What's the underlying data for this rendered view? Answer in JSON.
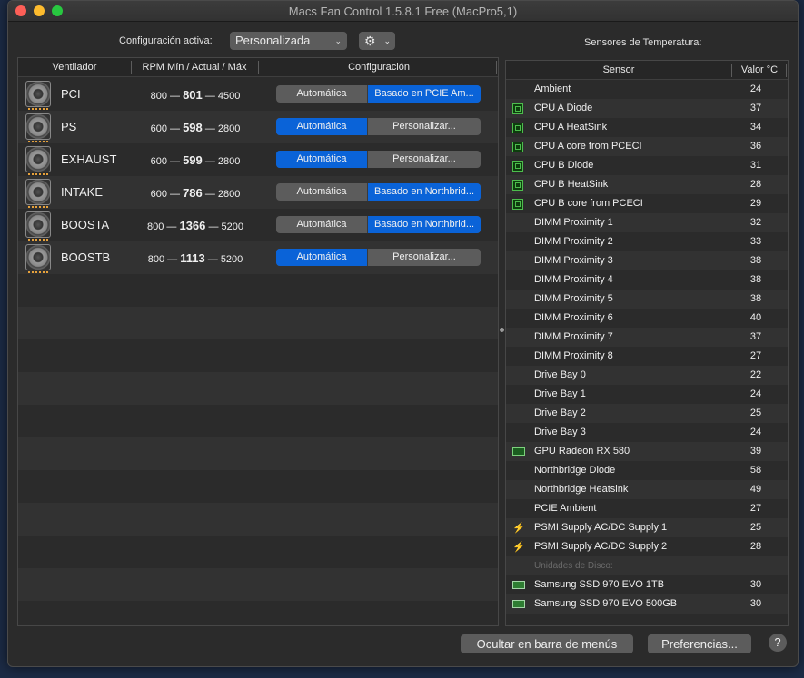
{
  "window": {
    "title": "Macs Fan Control 1.5.8.1 Free (MacPro5,1)"
  },
  "toolbar": {
    "config_label": "Configuración activa:",
    "config_value": "Personalizada",
    "sensors_label": "Sensores de Temperatura:"
  },
  "fans": {
    "headers": {
      "fan": "Ventilador",
      "rpm": "RPM Mín / Actual / Máx",
      "config": "Configuración"
    },
    "rows": [
      {
        "name": "PCI",
        "min": "800",
        "cur": "801",
        "max": "4500",
        "auto": "Automática",
        "custom": "Basado en PCIE Am...",
        "mode": "custom"
      },
      {
        "name": "PS",
        "min": "600",
        "cur": "598",
        "max": "2800",
        "auto": "Automática",
        "custom": "Personalizar...",
        "mode": "auto"
      },
      {
        "name": "EXHAUST",
        "min": "600",
        "cur": "599",
        "max": "2800",
        "auto": "Automática",
        "custom": "Personalizar...",
        "mode": "auto"
      },
      {
        "name": "INTAKE",
        "min": "600",
        "cur": "786",
        "max": "2800",
        "auto": "Automática",
        "custom": "Basado en Northbrid...",
        "mode": "custom"
      },
      {
        "name": "BOOSTA",
        "min": "800",
        "cur": "1366",
        "max": "5200",
        "auto": "Automática",
        "custom": "Basado en Northbrid...",
        "mode": "custom"
      },
      {
        "name": "BOOSTB",
        "min": "800",
        "cur": "1113",
        "max": "5200",
        "auto": "Automática",
        "custom": "Personalizar...",
        "mode": "auto"
      }
    ]
  },
  "sensors": {
    "headers": {
      "sensor": "Sensor",
      "value": "Valor °C"
    },
    "rows": [
      {
        "name": "Ambient",
        "value": "24",
        "icon": ""
      },
      {
        "name": "CPU A Diode",
        "value": "37",
        "icon": "chip-icon"
      },
      {
        "name": "CPU A HeatSink",
        "value": "34",
        "icon": "chip-icon"
      },
      {
        "name": "CPU A core from PCECI",
        "value": "36",
        "icon": "chip-icon"
      },
      {
        "name": "CPU B Diode",
        "value": "31",
        "icon": "chip-icon"
      },
      {
        "name": "CPU B HeatSink",
        "value": "28",
        "icon": "chip-icon"
      },
      {
        "name": "CPU B core from PCECI",
        "value": "29",
        "icon": "chip-icon"
      },
      {
        "name": "DIMM Proximity 1",
        "value": "32",
        "icon": ""
      },
      {
        "name": "DIMM Proximity 2",
        "value": "33",
        "icon": ""
      },
      {
        "name": "DIMM Proximity 3",
        "value": "38",
        "icon": ""
      },
      {
        "name": "DIMM Proximity 4",
        "value": "38",
        "icon": ""
      },
      {
        "name": "DIMM Proximity 5",
        "value": "38",
        "icon": ""
      },
      {
        "name": "DIMM Proximity 6",
        "value": "40",
        "icon": ""
      },
      {
        "name": "DIMM Proximity 7",
        "value": "37",
        "icon": ""
      },
      {
        "name": "DIMM Proximity 8",
        "value": "27",
        "icon": ""
      },
      {
        "name": "Drive Bay 0",
        "value": "22",
        "icon": ""
      },
      {
        "name": "Drive Bay 1",
        "value": "24",
        "icon": ""
      },
      {
        "name": "Drive Bay 2",
        "value": "25",
        "icon": ""
      },
      {
        "name": "Drive Bay 3",
        "value": "24",
        "icon": ""
      },
      {
        "name": "GPU Radeon RX 580",
        "value": "39",
        "icon": "gpu-icon"
      },
      {
        "name": "Northbridge Diode",
        "value": "58",
        "icon": ""
      },
      {
        "name": "Northbridge Heatsink",
        "value": "49",
        "icon": ""
      },
      {
        "name": "PCIE Ambient",
        "value": "27",
        "icon": ""
      },
      {
        "name": "PSMI Supply AC/DC Supply 1",
        "value": "25",
        "icon": "bolt-icon"
      },
      {
        "name": "PSMI Supply AC/DC Supply 2",
        "value": "28",
        "icon": "bolt-icon"
      },
      {
        "name": "Unidades de Disco:",
        "value": "",
        "icon": "",
        "group": true
      },
      {
        "name": "Samsung SSD 970 EVO 1TB",
        "value": "30",
        "icon": "ssd-icon"
      },
      {
        "name": "Samsung SSD 970 EVO 500GB",
        "value": "30",
        "icon": "ssd-icon"
      }
    ]
  },
  "footer": {
    "hide_label": "Ocultar en barra de menús",
    "prefs_label": "Preferencias...",
    "help_label": "?"
  },
  "colors": {
    "accent": "#0a63d8",
    "window_bg": "#2b2b2b"
  }
}
